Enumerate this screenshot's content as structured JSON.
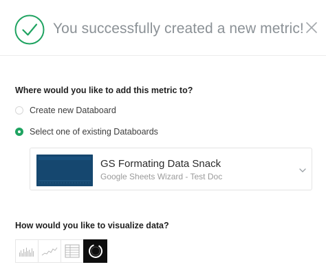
{
  "header": {
    "title": "You successfully created a new metric!",
    "success_icon": "checkmark-circle-icon",
    "close_icon": "close-icon"
  },
  "destination": {
    "question": "Where would you like to add this metric to?",
    "options": [
      {
        "label": "Create new Databoard",
        "selected": false
      },
      {
        "label": "Select one of existing Databoards",
        "selected": true
      }
    ],
    "selected_databoard": {
      "name": "GS Formating Data Snack",
      "subtitle": "Google Sheets Wizard - Test Doc",
      "dropdown_icon": "chevron-down-icon"
    }
  },
  "visualization": {
    "question": "How would you like to visualize data?",
    "options": [
      {
        "icon": "bar-chart-icon",
        "selected": false
      },
      {
        "icon": "line-chart-icon",
        "selected": false
      },
      {
        "icon": "table-icon",
        "selected": false
      },
      {
        "icon": "gauge-icon",
        "selected": true
      }
    ]
  },
  "colors": {
    "accent_green": "#1fa361",
    "title_gray": "#8b9196",
    "selected_viz_bg": "#0e0e0e"
  }
}
